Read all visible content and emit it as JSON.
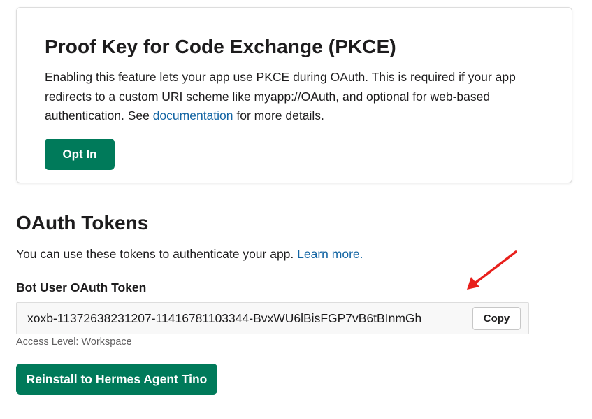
{
  "pkce": {
    "title": "Proof Key for Code Exchange (PKCE)",
    "description_before_link": "Enabling this feature lets your app use PKCE during OAuth. This is required if your app redirects to a custom URI scheme like myapp://OAuth, and optional for web-based authentication. See ",
    "documentation_link": "documentation",
    "description_after_link": " for more details.",
    "opt_in_label": "Opt In"
  },
  "oauth_tokens": {
    "title": "OAuth Tokens",
    "description": "You can use these tokens to authenticate your app. ",
    "learn_more_link": "Learn more.",
    "bot_token": {
      "label": "Bot User OAuth Token",
      "value": "xoxb-11372638231207-11416781103344-BvxWU6lBisFGP7vB6tBInmGh",
      "copy_label": "Copy",
      "access_level": "Access Level: Workspace"
    },
    "reinstall_label": "Reinstall to Hermes Agent Tino"
  },
  "annotation": {
    "arrow_color": "#e8201c"
  },
  "colors": {
    "primary_button": "#007a5a",
    "link": "#1264a3"
  }
}
